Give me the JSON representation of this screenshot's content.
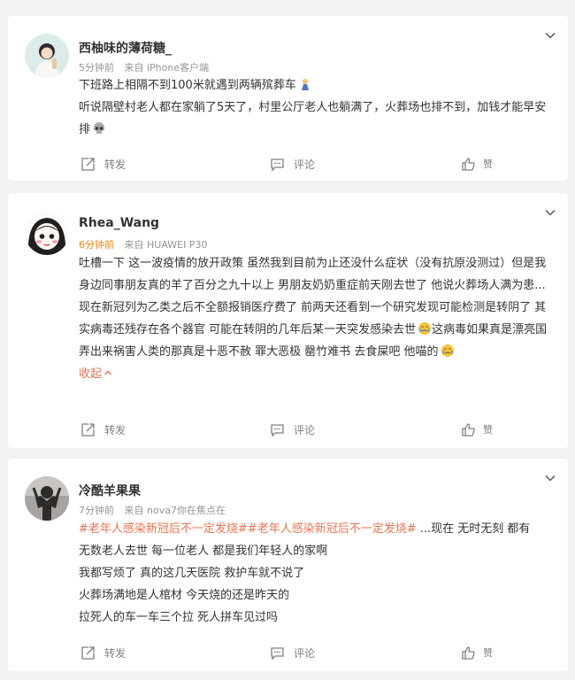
{
  "posts": [
    {
      "user_name": "西柚味的薄荷糖_",
      "time": "5分钟前",
      "source": "来自 iPhone客户端",
      "lines": [
        "下班路上相隔不到100米就遇到两辆殡葬车",
        "听说隔壁村老人都在家躺了5天了，村里公厅老人也躺满了，火葬场也排不到，加钱才能早安排"
      ],
      "emojis": [
        "pray-emoji",
        "skull-emoji"
      ]
    },
    {
      "user_name": "Rhea_Wang",
      "time": "6分钟前",
      "source": "来自 HUAWEI P30",
      "paragraph_1": "吐槽一下 这一波疫情的放开政策 虽然我到目前为止还没什么症状（没有抗原没测过）但是我身边同事朋友真的羊了百分之九十以上 男朋友奶奶重症前天刚去世了 他说火葬场人满为患...",
      "paragraph_2_a": "现在新冠列为乙类之后不全额报销医疗费了 前两天还看到一个研究发现可能检测是转阴了 其实病毒还残存在各个器官 可能在转阴的几年后某一天突发感染去世",
      "paragraph_2_b": "这病毒如果真是漂亮国弄出来祸害人类的那真是十恶不赦 罪大恶极 罄竹难书 去食屎吧 他喵的",
      "fold_label": "收起",
      "emojis": [
        "crying-emoji",
        "crying-emoji"
      ]
    },
    {
      "user_name": "冷酷羊果果",
      "time": "7分钟前",
      "source": "来自 nova7你在焦点在",
      "hashtag_1": "#老年人感染新冠后不一定发烧#",
      "hashtag_2": "#老年人感染新冠后不一定发烧#",
      "first_line_rest": " ...现在 无时无刻 都有",
      "lines": [
        "无数老人去世 每一位老人 都是我们年轻人的家啊",
        "我都写烦了 真的这几天医院 救护车就不说了",
        "火葬场满地是人棺材 今天烧的还是昨天的",
        "拉死人的车一车三个拉 死人拼车见过吗"
      ]
    }
  ],
  "actions": {
    "forward": "转发",
    "comment": "评论",
    "like": "赞"
  },
  "colors": {
    "background": "#f2f2f2",
    "card": "#ffffff",
    "hot_time": "#ff8200",
    "link": "#eb7350",
    "muted": "#939393"
  }
}
